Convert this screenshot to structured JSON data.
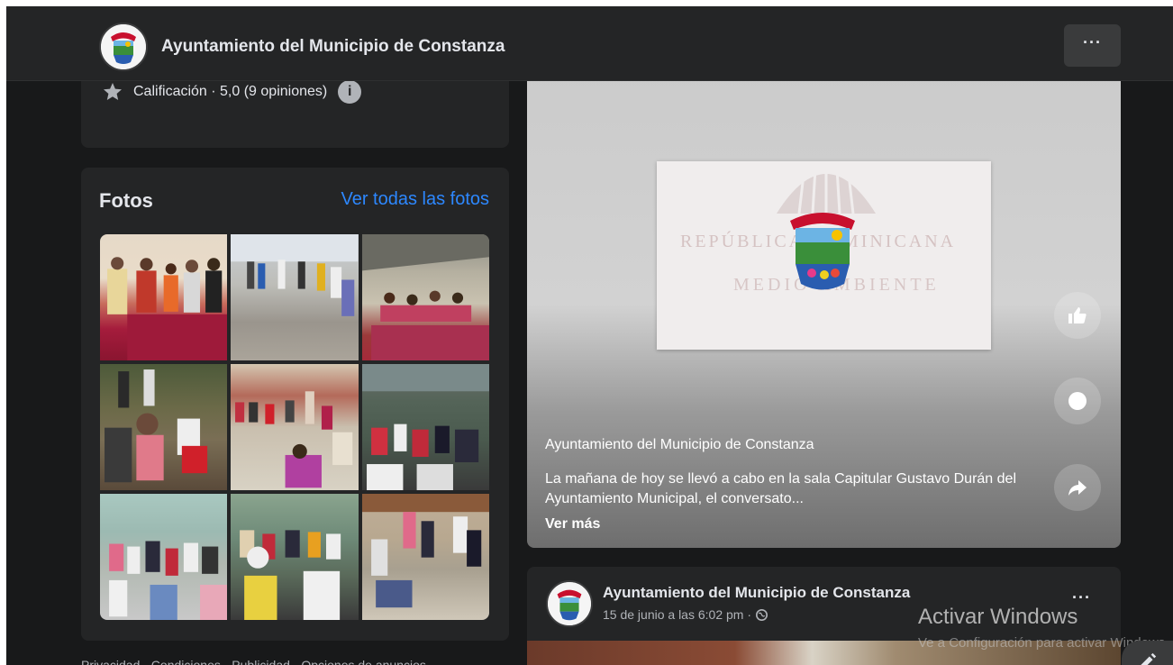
{
  "header": {
    "page_name": "Ayuntamiento del Municipio de Constanza",
    "more_label": "···"
  },
  "rating": {
    "text": "Calificación · 5,0 (9 opiniones)",
    "info_label": "i"
  },
  "photos": {
    "title": "Fotos",
    "see_all": "Ver todas las fotos",
    "items": [
      {
        "name": "photo-1"
      },
      {
        "name": "photo-2"
      },
      {
        "name": "photo-3"
      },
      {
        "name": "photo-4"
      },
      {
        "name": "photo-5"
      },
      {
        "name": "photo-6"
      },
      {
        "name": "photo-7"
      },
      {
        "name": "photo-8"
      },
      {
        "name": "photo-9"
      }
    ]
  },
  "footer": {
    "links": "Privacidad · Condiciones · Publicidad · Opciones de anuncios"
  },
  "video_post": {
    "watermark_line1": "REPÚBLICA DOMINICANA",
    "watermark_line2": "MEDIO AMBIENTE",
    "author": "Ayuntamiento del Municipio de Constanza",
    "caption": "La mañana de hoy se llevó a cabo en la sala Capitular Gustavo Durán del Ayuntamiento Municipal, el conversato...",
    "see_more": "Ver más"
  },
  "next_post": {
    "author": "Ayuntamiento del Municipio de Constanza",
    "meta": "15 de junio a las 6:02 pm ·",
    "dots": "···"
  },
  "windows_activation": {
    "title": "Activar Windows",
    "subtitle": "Ve a Configuración para activar Windows."
  },
  "colors": {
    "background": "#18191a",
    "card": "#242526",
    "link": "#2d88ff",
    "text": "#e4e6eb",
    "secondary_text": "#b0b3b8"
  },
  "icons": [
    "star-icon",
    "info-icon",
    "like-icon",
    "comment-icon",
    "share-icon",
    "globe-icon",
    "edit-icon"
  ]
}
